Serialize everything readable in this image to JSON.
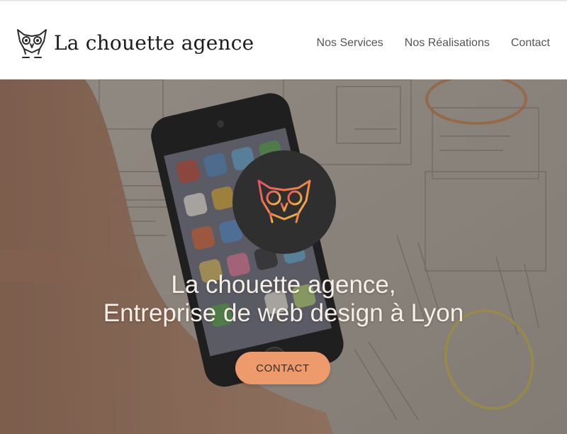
{
  "header": {
    "brand_name": "La chouette agence",
    "logo_icon": "owl-icon",
    "nav": [
      {
        "label": "Nos Services"
      },
      {
        "label": "Nos Réalisations"
      },
      {
        "label": "Contact"
      }
    ]
  },
  "hero": {
    "badge_icon": "owl-icon",
    "title_line1": "La chouette agence,",
    "title_line2": "Entreprise de web design à Lyon",
    "cta_label": "CONTACT"
  },
  "colors": {
    "accent": "#ed9a6d",
    "badge_bg": "#2f2f2f",
    "title_text": "#f7efe6",
    "nav_text": "#555555"
  }
}
